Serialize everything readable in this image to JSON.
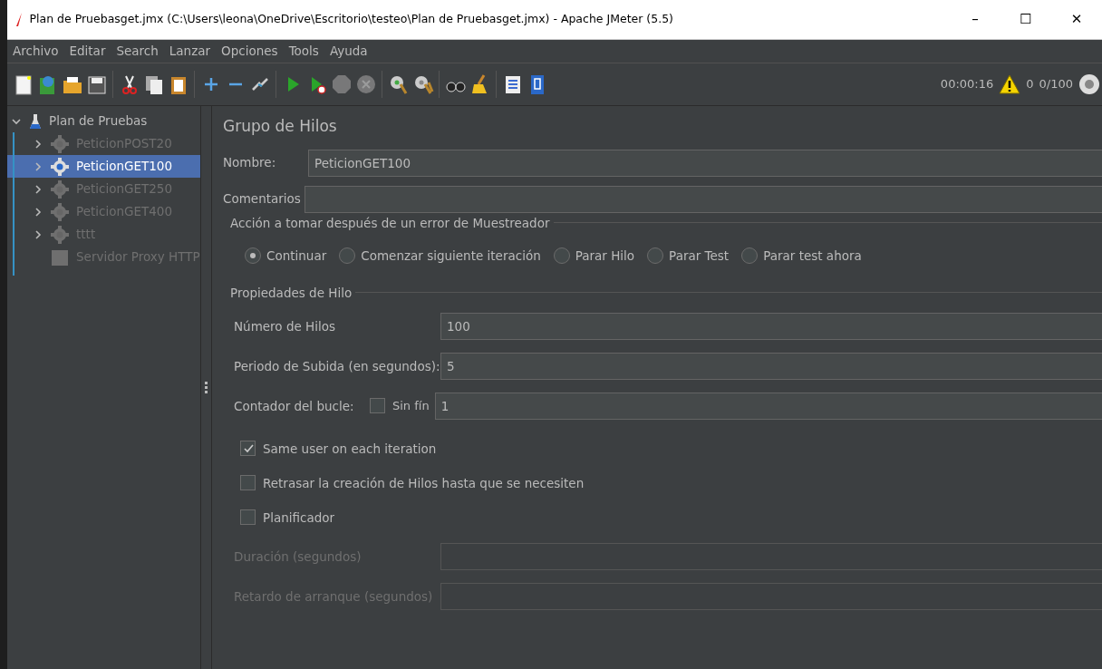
{
  "window": {
    "title": "Plan de Pruebasget.jmx (C:\\Users\\leona\\OneDrive\\Escritorio\\testeo\\Plan de Pruebasget.jmx) - Apache JMeter (5.5)",
    "controls": [
      "–",
      "☐",
      "✕"
    ]
  },
  "menu": [
    "Archivo",
    "Editar",
    "Search",
    "Lanzar",
    "Opciones",
    "Tools",
    "Ayuda"
  ],
  "toolbar": [
    {
      "kind": "new",
      "disabled": false
    },
    {
      "kind": "templates",
      "disabled": false
    },
    {
      "kind": "open",
      "disabled": false
    },
    {
      "kind": "save",
      "disabled": false
    },
    {
      "kind": "separator"
    },
    {
      "kind": "cut",
      "disabled": false
    },
    {
      "kind": "copy",
      "disabled": false
    },
    {
      "kind": "paste",
      "disabled": false
    },
    {
      "kind": "separator"
    },
    {
      "kind": "expand",
      "disabled": false
    },
    {
      "kind": "collapse",
      "disabled": false
    },
    {
      "kind": "toggle",
      "disabled": false
    },
    {
      "kind": "separator"
    },
    {
      "kind": "start",
      "disabled": false
    },
    {
      "kind": "start-no-pause",
      "disabled": false
    },
    {
      "kind": "stop",
      "disabled": true
    },
    {
      "kind": "shutdown",
      "disabled": true
    },
    {
      "kind": "separator"
    },
    {
      "kind": "remote-start",
      "disabled": false
    },
    {
      "kind": "remote-stop",
      "disabled": false
    },
    {
      "kind": "separator"
    },
    {
      "kind": "search",
      "disabled": false
    },
    {
      "kind": "clear",
      "disabled": false
    },
    {
      "kind": "separator"
    },
    {
      "kind": "functions",
      "disabled": false
    },
    {
      "kind": "help",
      "disabled": false
    }
  ],
  "status": {
    "elapsed": "00:00:16",
    "warnings": "0",
    "threads": "0/100"
  },
  "tree": {
    "label": "Plan de Pruebas",
    "expanded": true,
    "children": [
      {
        "label": "PeticionPOST20",
        "kind": "thread-group",
        "expanded": false,
        "disabled": true,
        "selected": false
      },
      {
        "label": "PeticionGET100",
        "kind": "thread-group",
        "expanded": false,
        "disabled": false,
        "selected": true
      },
      {
        "label": "PeticionGET250",
        "kind": "thread-group",
        "expanded": false,
        "disabled": true,
        "selected": false
      },
      {
        "label": "PeticionGET400",
        "kind": "thread-group",
        "expanded": false,
        "disabled": true,
        "selected": false
      },
      {
        "label": "tttt",
        "kind": "thread-group",
        "expanded": false,
        "disabled": true,
        "selected": false
      },
      {
        "label": "Servidor Proxy HTTP",
        "kind": "proxy",
        "disabled": true,
        "selected": false
      }
    ]
  },
  "panel": {
    "title": "Grupo de Hilos",
    "name": {
      "label": "Nombre:",
      "value": "PeticionGET100"
    },
    "comments": {
      "label": "Comentarios"
    },
    "error_action": {
      "legend": "Acción a tomar después de un error de Muestreador",
      "options": [
        {
          "label": "Continuar",
          "selected": true
        },
        {
          "label": "Comenzar siguiente iteración",
          "selected": false
        },
        {
          "label": "Parar Hilo",
          "selected": false
        },
        {
          "label": "Parar Test",
          "selected": false
        },
        {
          "label": "Parar test ahora",
          "selected": false
        }
      ]
    },
    "thread_properties": {
      "legend": "Propiedades de Hilo",
      "rows": [
        {
          "kind": "field",
          "label": "Número de Hilos",
          "value": "100",
          "disabled": false
        },
        {
          "kind": "field",
          "label": "Periodo de Subida (en segundos):",
          "value": "5",
          "disabled": false
        },
        {
          "kind": "loop",
          "label": "Contador del bucle:",
          "checkbox": {
            "label": "Sin fín",
            "checked": false
          },
          "value": "1",
          "disabled": false
        },
        {
          "kind": "check",
          "label": "Same user on each iteration",
          "checked": true
        },
        {
          "kind": "check",
          "label": "Retrasar la creación de Hilos hasta que se necesiten",
          "checked": false
        },
        {
          "kind": "check",
          "label": "Planificador",
          "checked": false
        },
        {
          "kind": "field",
          "label": "Duración (segundos)",
          "disabled": true
        },
        {
          "kind": "field",
          "label": "Retardo de arranque (segundos)",
          "disabled": true
        }
      ]
    }
  }
}
